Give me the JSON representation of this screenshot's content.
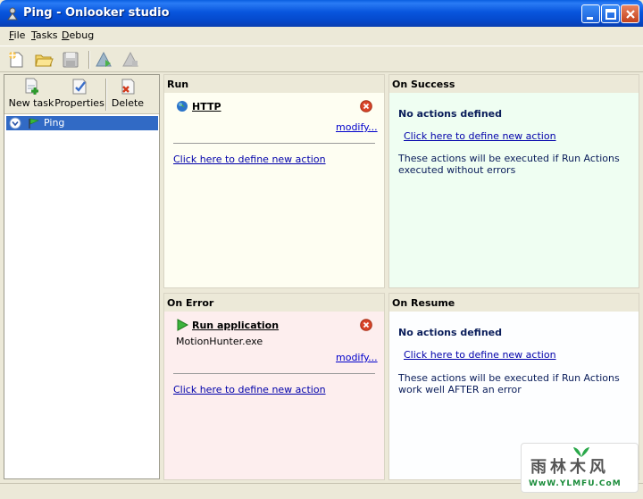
{
  "window": {
    "title": "Ping - Onlooker studio"
  },
  "menu": {
    "items": [
      "File",
      "Tasks",
      "Debug"
    ]
  },
  "left_toolbar": {
    "new_task": "New task",
    "properties": "Properties",
    "delete": "Delete"
  },
  "tree": {
    "items": [
      {
        "label": "Ping"
      }
    ]
  },
  "run": {
    "header": "Run",
    "action": {
      "title": "HTTP",
      "modify": "modify..."
    },
    "define_link": "Click here to define new action"
  },
  "on_success": {
    "header": "On Success",
    "empty_title": "No actions defined",
    "define_link": "Click here to define new action",
    "description": "These actions will be executed if Run Actions executed without errors"
  },
  "on_error": {
    "header": "On Error",
    "action": {
      "title": "Run application",
      "detail": "MotionHunter.exe",
      "modify": "modify..."
    },
    "define_link": "Click here to define new action"
  },
  "on_resume": {
    "header": "On Resume",
    "empty_title": "No actions defined",
    "define_link": "Click here to define new action",
    "description": "These actions will be executed if Run Actions work well AFTER an error"
  },
  "watermark": {
    "big": "雨林木风",
    "small": "WwW.YLMFU.CoM"
  },
  "colors": {
    "run_bg": "#fefef2",
    "success_bg": "#effef2",
    "error_bg": "#fdeeee",
    "resume_bg": "#fdfeff",
    "selection": "#316ac5"
  }
}
